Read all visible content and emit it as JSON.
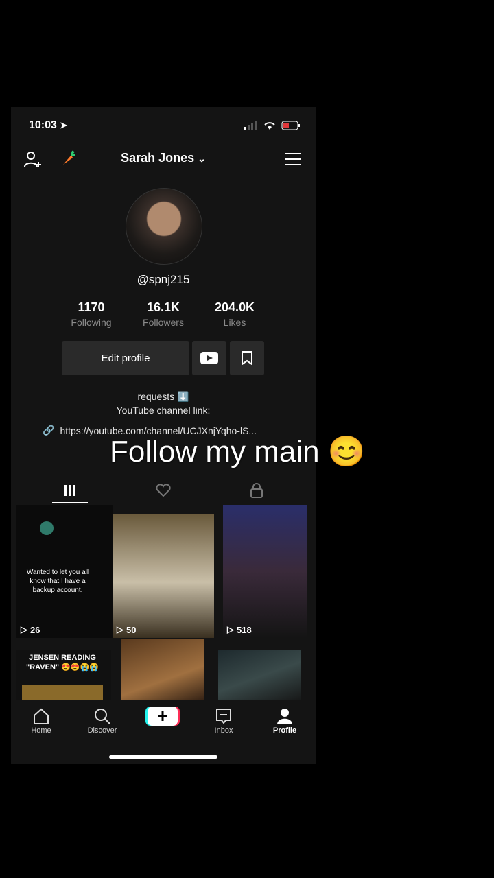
{
  "status_bar": {
    "time": "10:03"
  },
  "header": {
    "username": "Sarah Jones"
  },
  "profile": {
    "handle": "@spnj215",
    "stats": [
      {
        "value": "1170",
        "label": "Following"
      },
      {
        "value": "16.1K",
        "label": "Followers"
      },
      {
        "value": "204.0K",
        "label": "Likes"
      }
    ],
    "edit_button": "Edit profile",
    "bio_line1": "requests ⬇️",
    "bio_line2": "YouTube channel link:",
    "link": "https://youtube.com/channel/UCJXnjYqho-lS..."
  },
  "videos": [
    {
      "views": "26",
      "caption": "Wanted to let you all know that I have a backup account."
    },
    {
      "views": "50"
    },
    {
      "views": "518"
    },
    {
      "caption": "JENSEN READING \"RAVEN\" 😍😍😭😭"
    },
    {},
    {}
  ],
  "nav": {
    "home": "Home",
    "discover": "Discover",
    "inbox": "Inbox",
    "profile": "Profile"
  },
  "overlay_text": "Follow my main 😊"
}
